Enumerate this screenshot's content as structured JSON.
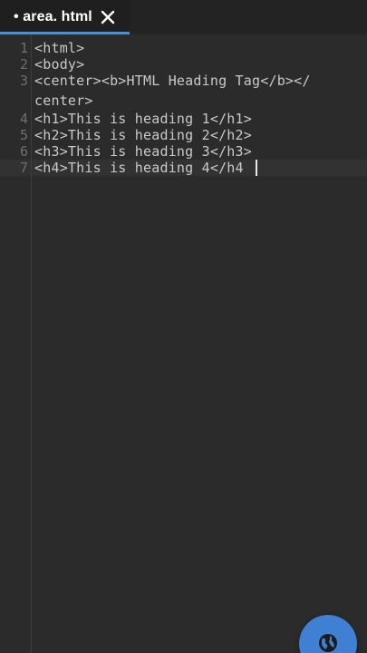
{
  "tab": {
    "label": "• area. html"
  },
  "editor": {
    "lines": [
      {
        "number": "1",
        "rows": [
          "<html>"
        ]
      },
      {
        "number": "2",
        "rows": [
          "<body>"
        ]
      },
      {
        "number": "3",
        "rows": [
          "<center><b>HTML Heading Tag</b></",
          "center>"
        ]
      },
      {
        "number": "4",
        "rows": [
          "<h1>This is heading 1</h1>"
        ]
      },
      {
        "number": "5",
        "rows": [
          "<h2>This is heading 2</h2>"
        ]
      },
      {
        "number": "6",
        "rows": [
          "<h3>This is heading 3</h3>"
        ]
      },
      {
        "number": "7",
        "rows": [
          "<h4>This is heading 4</h4"
        ]
      }
    ]
  },
  "colors": {
    "accent": "#4a90d9",
    "fab": "#3f7fd4",
    "background": "#2b2b2b"
  },
  "icons": {
    "tab_close": "close-icon",
    "fab": "globe-icon"
  }
}
